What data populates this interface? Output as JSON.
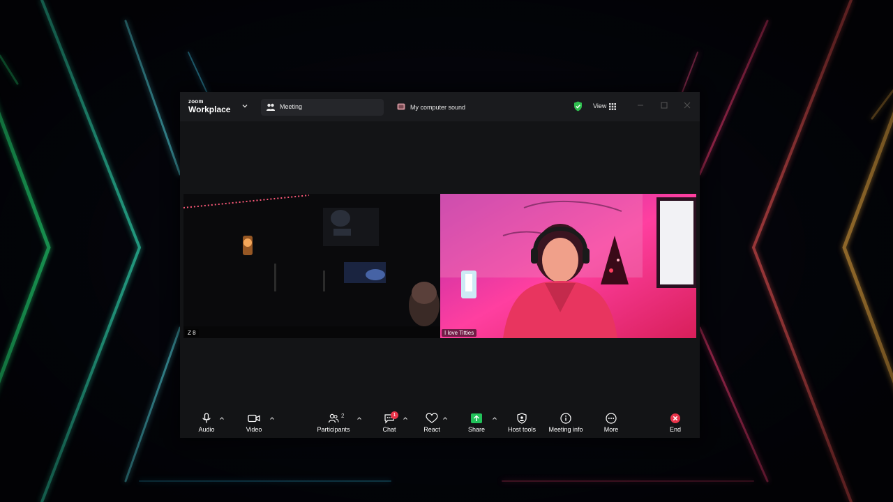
{
  "window": {
    "brand_small": "zoom",
    "brand_big": "Workplace",
    "meeting_tab_label": "Meeting",
    "sound_tab_label": "My computer sound",
    "view_label": "View"
  },
  "participants": [
    {
      "name": "Z 8"
    },
    {
      "name": "I love Titties"
    }
  ],
  "toolbar": {
    "audio": "Audio",
    "video": "Video",
    "participants": "Participants",
    "participants_count": "2",
    "chat": "Chat",
    "chat_badge": "1",
    "react": "React",
    "share": "Share",
    "host_tools": "Host tools",
    "meeting_info": "Meeting info",
    "more": "More",
    "end": "End"
  },
  "colors": {
    "share_green": "#22c25a",
    "shield_green": "#2fbf4f",
    "end_red": "#e8344a",
    "badge_red": "#e8344a"
  },
  "icons": [
    "chevron-down-icon",
    "meeting-icon",
    "sound-icon",
    "shield-icon",
    "grid-icon",
    "minimize-icon",
    "maximize-icon",
    "close-icon",
    "mic-icon",
    "camera-icon",
    "participants-icon",
    "chat-icon",
    "heart-icon",
    "share-icon",
    "host-tools-icon",
    "info-icon",
    "more-icon",
    "end-icon",
    "caret-up-icon"
  ]
}
